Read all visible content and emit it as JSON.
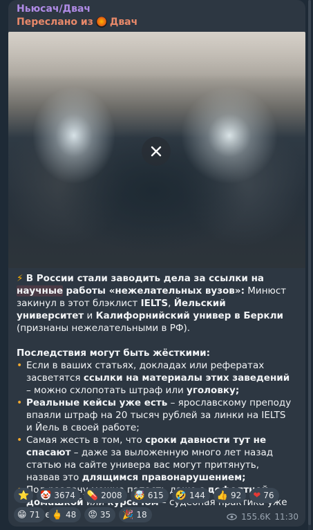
{
  "header": {
    "sender": "Ньюсач/Двач",
    "forward_prefix": "Переслано из",
    "forward_channel": "Двач"
  },
  "post": {
    "lead_icon": "⚡",
    "p1_a": "В России стали заводить дела за ссылки на ",
    "p1_hl": "научные",
    "p1_b": "работы «нежелательных вузов»:",
    "p1_c": " Минюст закинул в этот блэклист ",
    "p1_d": "IELTS",
    "p1_e": ", ",
    "p1_f": "Йельский университет",
    "p1_g": " и ",
    "p1_h": "Калифорнийский универ в Беркли",
    "p1_i": " (признаны нежелательными в РФ).",
    "heading2": "Последствия могут быть жёсткими",
    "heading2_colon": ":",
    "b1_a": "Если в ваших статьях, докладах или рефератах засветятся ",
    "b1_b": "ссылки на материалы этих заведений",
    "b1_c": " – можно схлопотать штраф или ",
    "b1_d": "уголовку;",
    "b2_a": "Реальные кейсы уже есть",
    "b2_b": " – ярославскому преподу впаяли штраф на 20 тысяч рублей за линки на IELTS и Йель в своей работе;",
    "b3_a": "Самая жесть в том, что ",
    "b3_b": "сроки давности тут не спасают",
    "b3_c": " – даже за выложенную много лет назад статью на сайте универа вас могут притянуть, назвав это ",
    "b3_d": "длящимся правонарушением;",
    "b4_a": "Под раздачу можно попасть даже с ",
    "b4_b": "дефолтной домашкой",
    "b4_c": " или ",
    "b4_d": "курсачом",
    "b4_e": " – судебная практика уже имеется.",
    "bullet_glyph": "•"
  },
  "reactions": {
    "row1": [
      {
        "icon": "star-icon",
        "emoji": "⭐",
        "count": ""
      },
      {
        "icon": "clown-icon",
        "emoji": "🤡",
        "count": "3674"
      },
      {
        "icon": "pill-icon",
        "emoji": "💊",
        "count": "2008"
      },
      {
        "icon": "mind-blown-icon",
        "emoji": "🤯",
        "count": "615"
      },
      {
        "icon": "rofl-icon",
        "emoji": "🤣",
        "count": "144"
      },
      {
        "icon": "thumbs-up-icon",
        "emoji": "👍",
        "count": "92"
      },
      {
        "icon": "heart-icon",
        "emoji": "❤",
        "count": "76"
      }
    ],
    "row2": [
      {
        "icon": "grin-icon",
        "emoji": "😁",
        "count": "71"
      },
      {
        "icon": "middle-finger-icon",
        "emoji": "🖕",
        "count": "48"
      },
      {
        "icon": "angry-icon",
        "emoji": "😡",
        "count": "35"
      },
      {
        "icon": "party-icon",
        "emoji": "🎉",
        "count": "18"
      }
    ]
  },
  "meta": {
    "views": "155.6K",
    "time": "11:30"
  },
  "colors": {
    "sender": "#b08be6",
    "forward": "#e9896a",
    "bubble": "#2d3742",
    "background": "#1e2a36",
    "reaction_bg": "#3a4653"
  }
}
